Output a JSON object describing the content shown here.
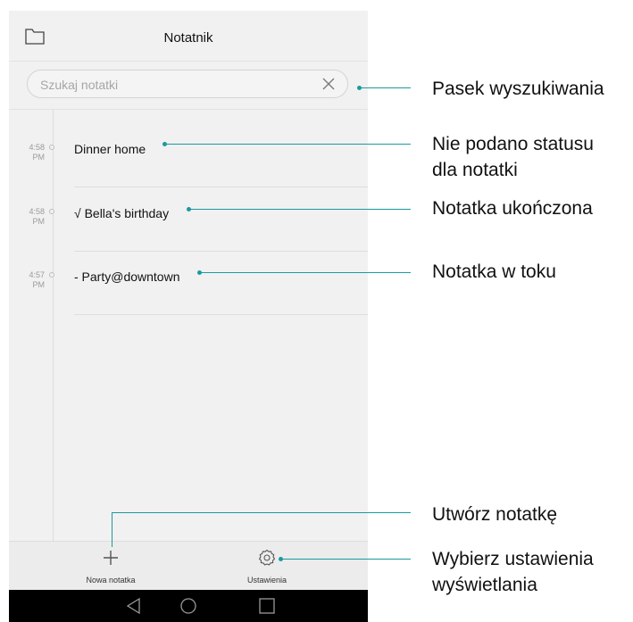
{
  "app": {
    "title": "Notatnik"
  },
  "search": {
    "placeholder": "Szukaj notatki"
  },
  "notes": [
    {
      "time": "4:58",
      "meridiem": "PM",
      "text": "Dinner home"
    },
    {
      "time": "4:58",
      "meridiem": "PM",
      "text": "√ Bella's birthday"
    },
    {
      "time": "4:57",
      "meridiem": "PM",
      "text": "- Party@downtown"
    }
  ],
  "bottombar": {
    "new_note_label": "Nowa notatka",
    "settings_label": "Ustawienia"
  },
  "callouts": {
    "search_bar": "Pasek wyszukiwania",
    "no_status": "Nie podano statusu\ndla notatki",
    "done": "Notatka ukończona",
    "in_progress": "Notatka w toku",
    "create": "Utwórz notatkę",
    "display_settings": "Wybierz ustawienia\nwyświetlania"
  },
  "colors": {
    "callout_accent": "#1a9aa0",
    "screen_background": "#f1f1f1",
    "nav_background": "#000000"
  },
  "icons": {
    "folder": "folder-icon",
    "clear": "close-icon",
    "add": "plus-icon",
    "settings": "gear-icon",
    "back": "back-triangle-icon",
    "home": "home-circle-icon",
    "recents": "recents-square-icon"
  }
}
